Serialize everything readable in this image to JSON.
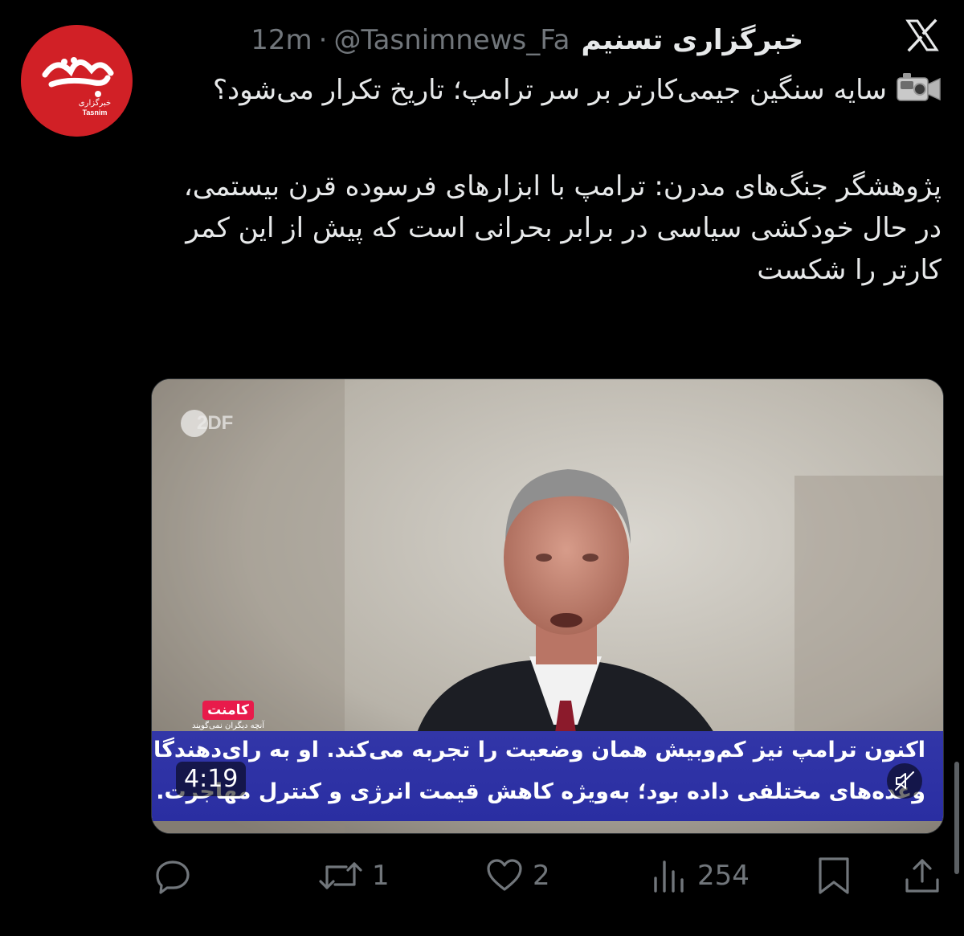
{
  "account": {
    "display_name": "خبرگزاری تسنیم",
    "handle": "@Tasnimnews_Fa",
    "separator": "·",
    "time": "12m",
    "avatar_text": "تسنیم",
    "avatar_subtext": "خبرگزاری",
    "avatar_latin": "Tasnim"
  },
  "tweet": {
    "line1": "سایه سنگین جیمی‌کارتر بر سر ترامپ؛ تاریخ تکرار می‌شود؟",
    "paragraph2": "پژوهشگر جنگ‌های مدرن: ترامپ با ابزارهای فرسوده قرن بیستمی، در حال خودکشی سیاسی در برابر بحرانی است که پیش از این کمر کارتر را شکست",
    "emoji_icon": "video-camera-icon"
  },
  "video": {
    "channel_logo": "2DF",
    "overlay_brand": "کامنت",
    "overlay_brand_sub": "آنچه دیگران نمی‌گویند",
    "subtitle_line1": "اکنون ترامپ نیز کم‌وبیش همان وضعیت را تجربه می‌کند. او به رای‌دهندگانش",
    "subtitle_line2": "وعده‌های مختلفی داده بود؛ به‌ویژه کاهش قیمت انرژی و کنترل مهاجرت.",
    "duration": "4:19",
    "muted": true
  },
  "actions": {
    "reply_count": "",
    "retweet_count": "1",
    "like_count": "2",
    "views_count": "254"
  },
  "colors": {
    "background": "#000000",
    "text": "#e7e9ea",
    "muted_text": "#71767b",
    "avatar_red": "#d12026",
    "subtitle_bar": "#2e32a6"
  }
}
